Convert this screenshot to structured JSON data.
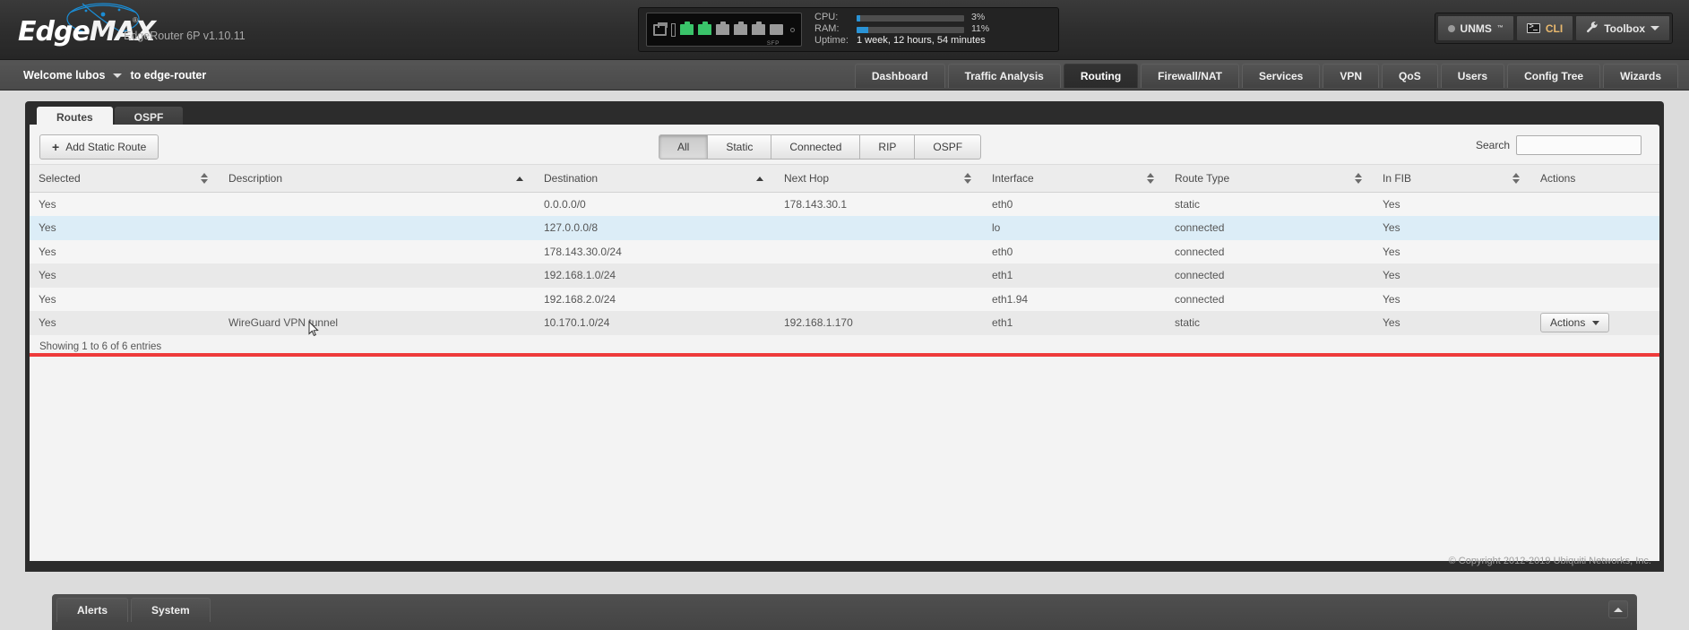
{
  "brand": {
    "logo_edge": "Edge",
    "logo_max": "MAX",
    "registered_mark": "®",
    "model": "EdgeRouter 6P v1.10.11"
  },
  "device_panel": {
    "ports": [
      {
        "name": "console",
        "state": "console"
      },
      {
        "name": "eth0",
        "state": "up"
      },
      {
        "name": "eth1",
        "state": "up"
      },
      {
        "name": "eth2",
        "state": "down"
      },
      {
        "name": "eth3",
        "state": "down"
      },
      {
        "name": "eth4",
        "state": "down"
      },
      {
        "name": "eth5",
        "state": "sfp"
      }
    ],
    "sfp_label": "SFP",
    "cpu_label": "CPU:",
    "cpu_value": "3%",
    "cpu_percent": 3,
    "ram_label": "RAM:",
    "ram_value": "11%",
    "ram_percent": 11,
    "uptime_label": "Uptime:",
    "uptime_value": "1 week, 12 hours, 54 minutes"
  },
  "top_actions": {
    "unms_label": "UNMS",
    "unms_sup": "™",
    "cli_label": "CLI",
    "toolbox_label": "Toolbox"
  },
  "navbar": {
    "welcome": "Welcome lubos",
    "device": "to edge-router",
    "tabs": [
      {
        "label": "Dashboard",
        "active": false
      },
      {
        "label": "Traffic Analysis",
        "active": false
      },
      {
        "label": "Routing",
        "active": true
      },
      {
        "label": "Firewall/NAT",
        "active": false
      },
      {
        "label": "Services",
        "active": false
      },
      {
        "label": "VPN",
        "active": false
      },
      {
        "label": "QoS",
        "active": false
      },
      {
        "label": "Users",
        "active": false
      },
      {
        "label": "Config Tree",
        "active": false
      },
      {
        "label": "Wizards",
        "active": false
      }
    ]
  },
  "subtabs": [
    {
      "label": "Routes",
      "active": true
    },
    {
      "label": "OSPF",
      "active": false
    }
  ],
  "toolbar": {
    "add_route_label": "Add Static Route",
    "add_icon": "+",
    "filters": [
      {
        "label": "All",
        "active": true
      },
      {
        "label": "Static",
        "active": false
      },
      {
        "label": "Connected",
        "active": false
      },
      {
        "label": "RIP",
        "active": false
      },
      {
        "label": "OSPF",
        "active": false
      }
    ],
    "search_label": "Search",
    "search_value": "",
    "search_placeholder": ""
  },
  "table": {
    "columns": [
      {
        "label": "Selected",
        "sort": "both"
      },
      {
        "label": "Description",
        "sort": "asc"
      },
      {
        "label": "Destination",
        "sort": "asc"
      },
      {
        "label": "Next Hop",
        "sort": "both"
      },
      {
        "label": "Interface",
        "sort": "both"
      },
      {
        "label": "Route Type",
        "sort": "both"
      },
      {
        "label": "In FIB",
        "sort": "both"
      },
      {
        "label": "Actions",
        "sort": "none"
      }
    ],
    "rows": [
      {
        "selected": "Yes",
        "description": "",
        "destination": "0.0.0.0/0",
        "next_hop": "178.143.30.1",
        "interface": "eth0",
        "route_type": "static",
        "in_fib": "Yes",
        "has_actions": false
      },
      {
        "selected": "Yes",
        "description": "",
        "destination": "127.0.0.0/8",
        "next_hop": "",
        "interface": "lo",
        "route_type": "connected",
        "in_fib": "Yes",
        "has_actions": false
      },
      {
        "selected": "Yes",
        "description": "",
        "destination": "178.143.30.0/24",
        "next_hop": "",
        "interface": "eth0",
        "route_type": "connected",
        "in_fib": "Yes",
        "has_actions": false
      },
      {
        "selected": "Yes",
        "description": "",
        "destination": "192.168.1.0/24",
        "next_hop": "",
        "interface": "eth1",
        "route_type": "connected",
        "in_fib": "Yes",
        "has_actions": false
      },
      {
        "selected": "Yes",
        "description": "",
        "destination": "192.168.2.0/24",
        "next_hop": "",
        "interface": "eth1.94",
        "route_type": "connected",
        "in_fib": "Yes",
        "has_actions": false
      },
      {
        "selected": "Yes",
        "description": "WireGuard VPN tunnel",
        "destination": "10.170.1.0/24",
        "next_hop": "192.168.1.170",
        "interface": "eth1",
        "route_type": "static",
        "in_fib": "Yes",
        "has_actions": true
      }
    ],
    "actions_label": "Actions",
    "showing_text": "Showing 1 to 6 of 6 entries"
  },
  "footer": {
    "copyright": "© Copyright 2012-2019 Ubiquiti Networks, Inc.",
    "buttons": [
      {
        "label": "Alerts"
      },
      {
        "label": "System"
      }
    ]
  },
  "colors": {
    "accent_blue": "#2a93d5",
    "port_up_green": "#3ac46a",
    "highlight_red": "#ee3a3a",
    "row_hover_blue": "#dcedf7"
  }
}
